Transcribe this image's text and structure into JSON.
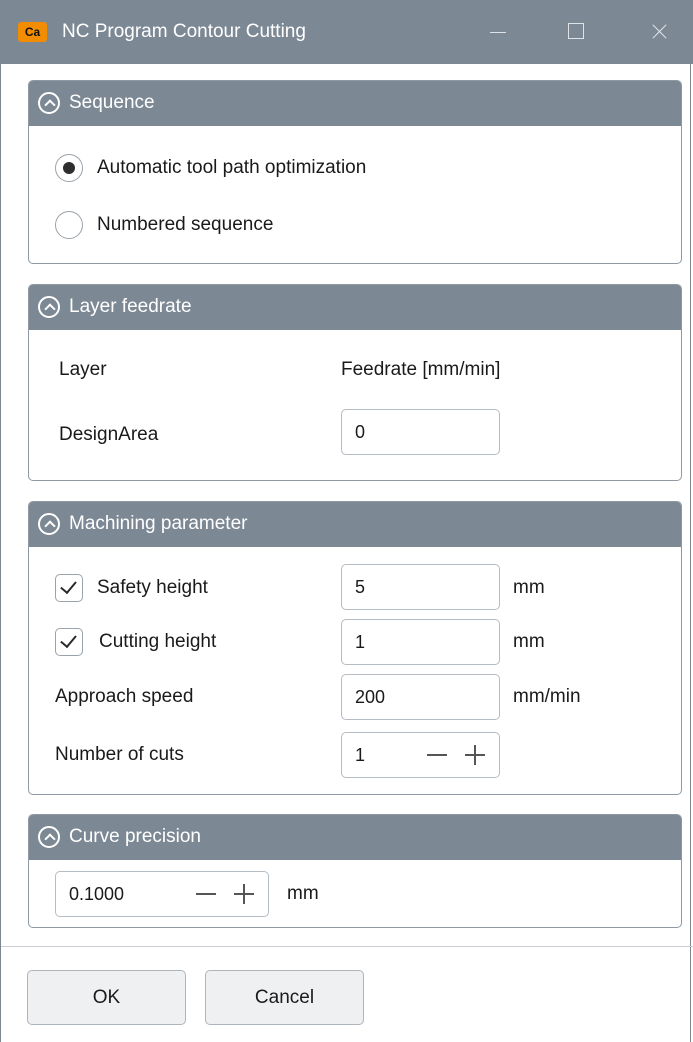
{
  "window": {
    "title": "NC Program Contour Cutting",
    "app_icon_text": "Ca",
    "accent_color": "#7c8894",
    "app_icon_color": "#f28c00"
  },
  "sequence": {
    "title": "Sequence",
    "options": [
      {
        "label": "Automatic tool path optimization",
        "checked": true
      },
      {
        "label": "Numbered sequence",
        "checked": false
      }
    ]
  },
  "layer_feedrate": {
    "title": "Layer feedrate",
    "col_layer": "Layer",
    "col_feedrate": "Feedrate [mm/min]",
    "rows": [
      {
        "layer": "DesignArea",
        "feedrate": "0"
      }
    ]
  },
  "machining": {
    "title": "Machining parameter",
    "safety_height": {
      "label": "Safety height",
      "value": "5",
      "unit": "mm",
      "checked": true
    },
    "cutting_height": {
      "label": "Cutting height",
      "value": "1",
      "unit": "mm",
      "checked": true
    },
    "approach_speed": {
      "label": "Approach speed",
      "value": "200",
      "unit": "mm/min"
    },
    "number_of_cuts": {
      "label": "Number of cuts",
      "value": "1"
    }
  },
  "curve_precision": {
    "title": "Curve precision",
    "value": "0.1000",
    "unit": "mm"
  },
  "buttons": {
    "ok": "OK",
    "cancel": "Cancel"
  }
}
